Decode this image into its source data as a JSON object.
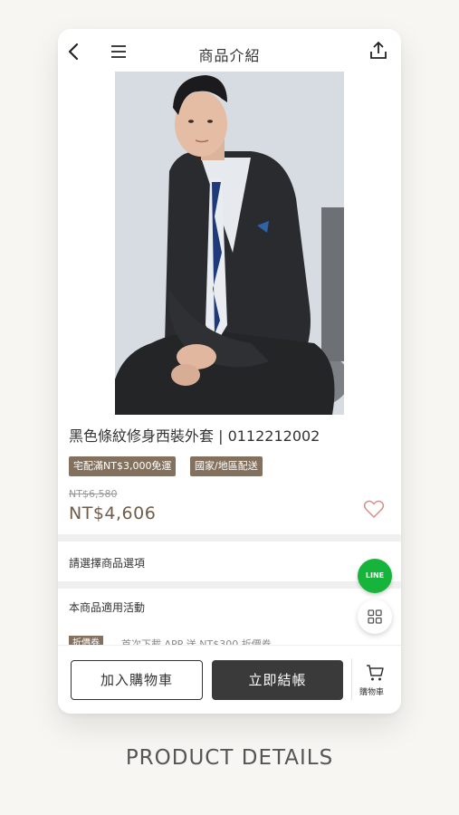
{
  "header": {
    "title": "商品介紹"
  },
  "product": {
    "name": "黑色條紋修身西裝外套 | 0112212002",
    "tags": [
      "宅配滿NT$3,000免運",
      "國家/地區配送"
    ],
    "original_price": "NT$6,580",
    "price": "NT$4,606"
  },
  "options": {
    "label": "請選擇商品選項"
  },
  "activities": {
    "label": "本商品適用活動",
    "promo_tag": "折價券",
    "promo_text": "首次下載 APP 送 NT$300 折價券"
  },
  "floating": {
    "line_label": "LINE"
  },
  "bottom_bar": {
    "add_to_cart": "加入購物車",
    "buy_now": "立即結帳",
    "cart_label": "購物車"
  },
  "caption": "PRODUCT DETAILS",
  "colors": {
    "brand_tag": "#83715e",
    "price": "#6f5c4b",
    "line_green": "#17b43c",
    "buy_button": "#3a3a3a"
  },
  "icons": [
    "back-arrow-icon",
    "hamburger-menu-icon",
    "share-icon",
    "heart-icon",
    "line-chat-icon",
    "grid-icon",
    "cart-icon"
  ]
}
